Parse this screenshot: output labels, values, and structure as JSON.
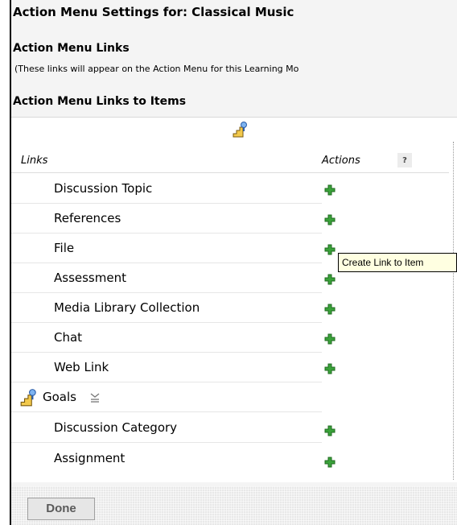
{
  "header": {
    "title": "Action Menu Settings for: Classical Music"
  },
  "links_section": {
    "title": "Action Menu Links",
    "note": "(These links will appear on the Action Menu for this Learning Mo"
  },
  "items_section": {
    "title": "Action Menu Links to Items"
  },
  "table": {
    "col_links": "Links",
    "col_actions": "Actions",
    "help_icon": "?",
    "rows": [
      {
        "label": "Discussion Topic",
        "icon": "add-icon"
      },
      {
        "label": "References",
        "icon": "add-icon"
      },
      {
        "label": "File",
        "icon": "add-icon"
      },
      {
        "label": "Assessment",
        "icon": "add-icon"
      },
      {
        "label": "Media Library Collection",
        "icon": "add-icon"
      },
      {
        "label": "Chat",
        "icon": "add-icon"
      },
      {
        "label": "Web Link",
        "icon": "add-icon"
      }
    ],
    "group": {
      "label": "Goals",
      "icon": "stairs-drag-icon"
    },
    "group_rows": [
      {
        "label": "Discussion Category",
        "icon": "add-icon"
      },
      {
        "label": "Assignment",
        "icon": "add-icon"
      }
    ]
  },
  "tooltip": {
    "text": "Create Link to Item"
  },
  "footer": {
    "done_label": "Done"
  },
  "colors": {
    "plus_green": "#3aa23a",
    "tooltip_bg": "#ffffe1"
  }
}
